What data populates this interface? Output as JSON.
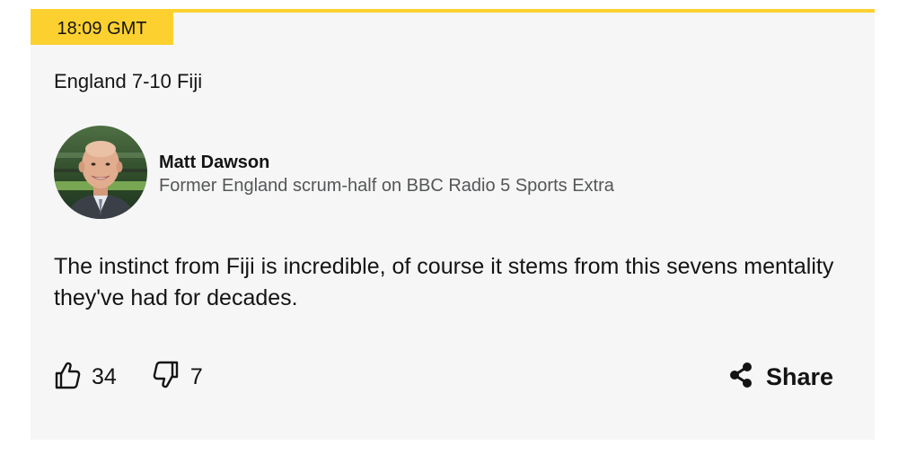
{
  "post": {
    "time": "18:09 GMT",
    "headline": "England 7-10 Fiji",
    "author": {
      "name": "Matt Dawson",
      "role": "Former England scrum-half on BBC Radio 5 Sports Extra"
    },
    "quote": "The instinct from Fiji is incredible, of course it stems from this sevens mentality they've had for decades.",
    "likes": "34",
    "dislikes": "7",
    "share_label": "Share"
  },
  "colors": {
    "accent": "#fcd12f",
    "card_background": "#f6f6f6",
    "text": "#141414",
    "secondary_text": "#545658"
  },
  "icons": {
    "like": "thumbs-up-icon",
    "dislike": "thumbs-down-icon",
    "share": "share-icon"
  }
}
